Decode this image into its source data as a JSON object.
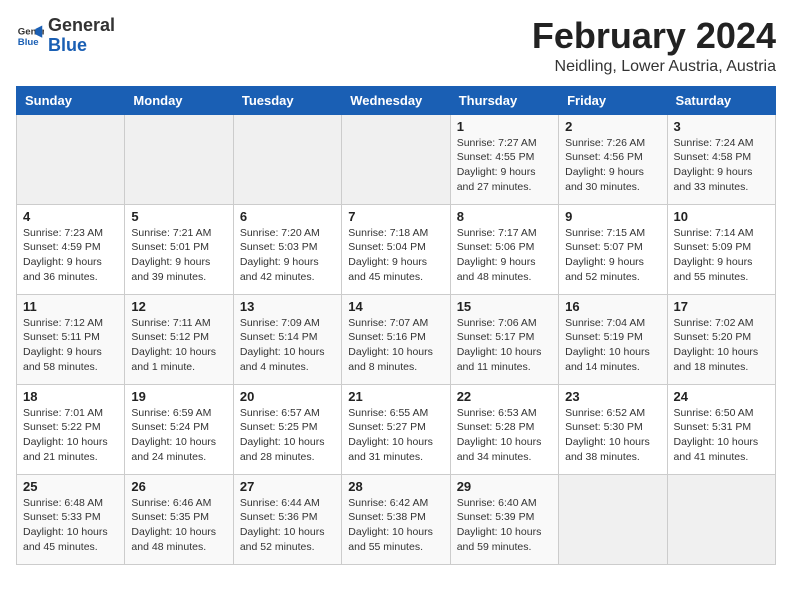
{
  "header": {
    "logo_general": "General",
    "logo_blue": "Blue",
    "month_title": "February 2024",
    "location": "Neidling, Lower Austria, Austria"
  },
  "weekdays": [
    "Sunday",
    "Monday",
    "Tuesday",
    "Wednesday",
    "Thursday",
    "Friday",
    "Saturday"
  ],
  "weeks": [
    [
      {
        "day": "",
        "info": ""
      },
      {
        "day": "",
        "info": ""
      },
      {
        "day": "",
        "info": ""
      },
      {
        "day": "",
        "info": ""
      },
      {
        "day": "1",
        "info": "Sunrise: 7:27 AM\nSunset: 4:55 PM\nDaylight: 9 hours\nand 27 minutes."
      },
      {
        "day": "2",
        "info": "Sunrise: 7:26 AM\nSunset: 4:56 PM\nDaylight: 9 hours\nand 30 minutes."
      },
      {
        "day": "3",
        "info": "Sunrise: 7:24 AM\nSunset: 4:58 PM\nDaylight: 9 hours\nand 33 minutes."
      }
    ],
    [
      {
        "day": "4",
        "info": "Sunrise: 7:23 AM\nSunset: 4:59 PM\nDaylight: 9 hours\nand 36 minutes."
      },
      {
        "day": "5",
        "info": "Sunrise: 7:21 AM\nSunset: 5:01 PM\nDaylight: 9 hours\nand 39 minutes."
      },
      {
        "day": "6",
        "info": "Sunrise: 7:20 AM\nSunset: 5:03 PM\nDaylight: 9 hours\nand 42 minutes."
      },
      {
        "day": "7",
        "info": "Sunrise: 7:18 AM\nSunset: 5:04 PM\nDaylight: 9 hours\nand 45 minutes."
      },
      {
        "day": "8",
        "info": "Sunrise: 7:17 AM\nSunset: 5:06 PM\nDaylight: 9 hours\nand 48 minutes."
      },
      {
        "day": "9",
        "info": "Sunrise: 7:15 AM\nSunset: 5:07 PM\nDaylight: 9 hours\nand 52 minutes."
      },
      {
        "day": "10",
        "info": "Sunrise: 7:14 AM\nSunset: 5:09 PM\nDaylight: 9 hours\nand 55 minutes."
      }
    ],
    [
      {
        "day": "11",
        "info": "Sunrise: 7:12 AM\nSunset: 5:11 PM\nDaylight: 9 hours\nand 58 minutes."
      },
      {
        "day": "12",
        "info": "Sunrise: 7:11 AM\nSunset: 5:12 PM\nDaylight: 10 hours\nand 1 minute."
      },
      {
        "day": "13",
        "info": "Sunrise: 7:09 AM\nSunset: 5:14 PM\nDaylight: 10 hours\nand 4 minutes."
      },
      {
        "day": "14",
        "info": "Sunrise: 7:07 AM\nSunset: 5:16 PM\nDaylight: 10 hours\nand 8 minutes."
      },
      {
        "day": "15",
        "info": "Sunrise: 7:06 AM\nSunset: 5:17 PM\nDaylight: 10 hours\nand 11 minutes."
      },
      {
        "day": "16",
        "info": "Sunrise: 7:04 AM\nSunset: 5:19 PM\nDaylight: 10 hours\nand 14 minutes."
      },
      {
        "day": "17",
        "info": "Sunrise: 7:02 AM\nSunset: 5:20 PM\nDaylight: 10 hours\nand 18 minutes."
      }
    ],
    [
      {
        "day": "18",
        "info": "Sunrise: 7:01 AM\nSunset: 5:22 PM\nDaylight: 10 hours\nand 21 minutes."
      },
      {
        "day": "19",
        "info": "Sunrise: 6:59 AM\nSunset: 5:24 PM\nDaylight: 10 hours\nand 24 minutes."
      },
      {
        "day": "20",
        "info": "Sunrise: 6:57 AM\nSunset: 5:25 PM\nDaylight: 10 hours\nand 28 minutes."
      },
      {
        "day": "21",
        "info": "Sunrise: 6:55 AM\nSunset: 5:27 PM\nDaylight: 10 hours\nand 31 minutes."
      },
      {
        "day": "22",
        "info": "Sunrise: 6:53 AM\nSunset: 5:28 PM\nDaylight: 10 hours\nand 34 minutes."
      },
      {
        "day": "23",
        "info": "Sunrise: 6:52 AM\nSunset: 5:30 PM\nDaylight: 10 hours\nand 38 minutes."
      },
      {
        "day": "24",
        "info": "Sunrise: 6:50 AM\nSunset: 5:31 PM\nDaylight: 10 hours\nand 41 minutes."
      }
    ],
    [
      {
        "day": "25",
        "info": "Sunrise: 6:48 AM\nSunset: 5:33 PM\nDaylight: 10 hours\nand 45 minutes."
      },
      {
        "day": "26",
        "info": "Sunrise: 6:46 AM\nSunset: 5:35 PM\nDaylight: 10 hours\nand 48 minutes."
      },
      {
        "day": "27",
        "info": "Sunrise: 6:44 AM\nSunset: 5:36 PM\nDaylight: 10 hours\nand 52 minutes."
      },
      {
        "day": "28",
        "info": "Sunrise: 6:42 AM\nSunset: 5:38 PM\nDaylight: 10 hours\nand 55 minutes."
      },
      {
        "day": "29",
        "info": "Sunrise: 6:40 AM\nSunset: 5:39 PM\nDaylight: 10 hours\nand 59 minutes."
      },
      {
        "day": "",
        "info": ""
      },
      {
        "day": "",
        "info": ""
      }
    ]
  ]
}
